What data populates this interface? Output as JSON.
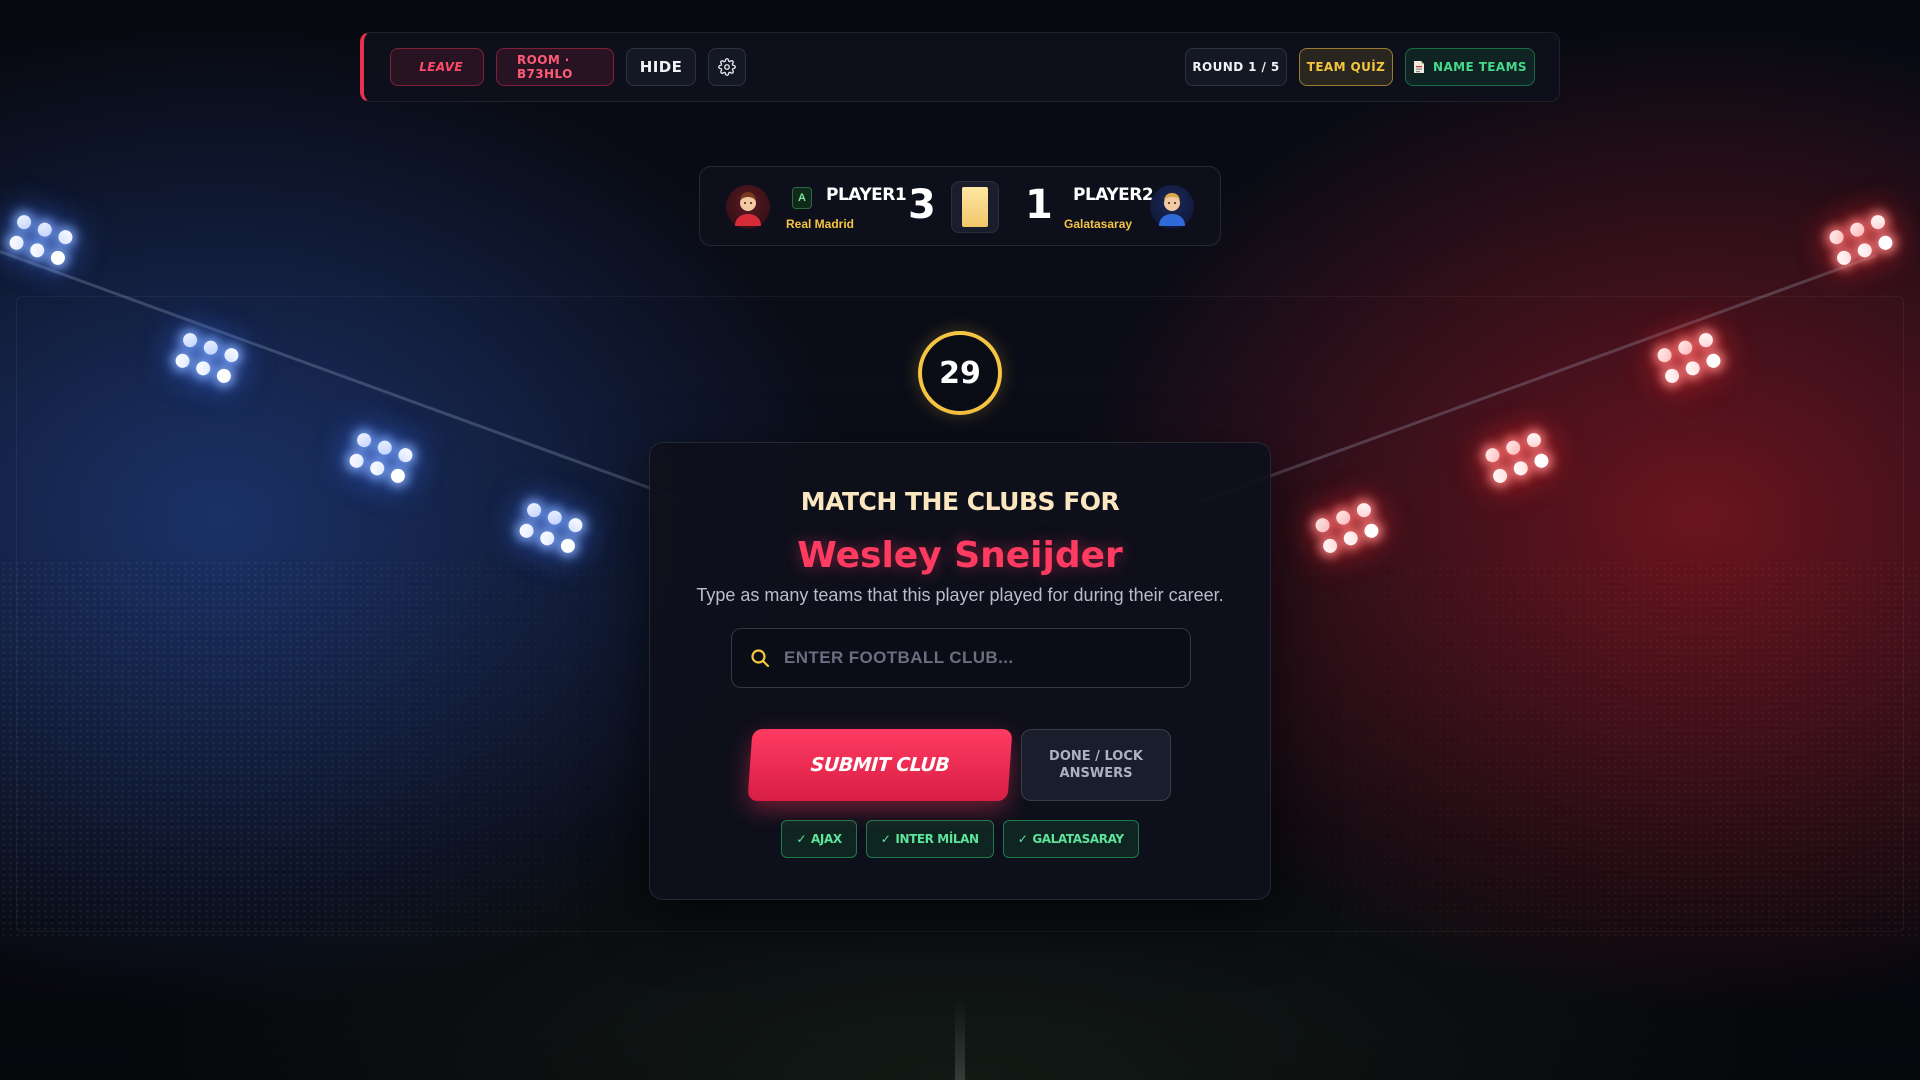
{
  "topbar": {
    "leave_label": "LEAVE",
    "room_label": "ROOM · B73HLO",
    "hide_label": "HIDE",
    "round_label": "ROUND 1 / 5",
    "quiz_label": "TEAM QUİZ",
    "name_teams_label": "NAME TEAMS"
  },
  "scoreboard": {
    "player1": {
      "name": "PLAYER1",
      "team": "Real Madrid",
      "score": "3",
      "badge": "A"
    },
    "player2": {
      "name": "PLAYER2",
      "team": "Galatasaray",
      "score": "1"
    }
  },
  "timer": {
    "seconds": "29"
  },
  "question": {
    "title": "MATCH THE CLUBS FOR",
    "player": "Wesley Sneijder",
    "description": "Type as many teams that this player played for during their career."
  },
  "search": {
    "placeholder": "ENTER FOOTBALL CLUB...",
    "value": ""
  },
  "actions": {
    "submit_label": "SUBMIT CLUB",
    "done_label": "DONE / LOCK ANSWERS"
  },
  "answers": [
    {
      "label": "AJAX"
    },
    {
      "label": "INTER MİLAN"
    },
    {
      "label": "GALATASARAY"
    }
  ],
  "colors": {
    "accent_red": "#e8304f",
    "accent_gold": "#f5c542",
    "accent_green": "#46d98a"
  }
}
